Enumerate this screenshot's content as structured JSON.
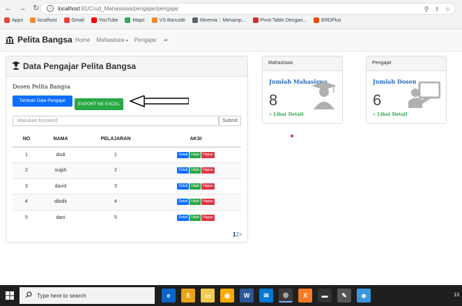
{
  "browser": {
    "url_host": "localhost",
    "url_path": ":81/Crud_Mahasiswa/pengajar/pengajar",
    "bookmarks": [
      {
        "label": "Apps",
        "color": "#e8453c"
      },
      {
        "label": "localhost",
        "color": "#f28b30"
      },
      {
        "label": "Gmail",
        "color": "#ea4335"
      },
      {
        "label": "YouTube",
        "color": "#ff0000"
      },
      {
        "label": "Maps",
        "color": "#34a853"
      },
      {
        "label": "VS Barcode",
        "color": "#f28b30"
      },
      {
        "label": "Minerva :: Menamp...",
        "color": "#5f6368"
      },
      {
        "label": "Pivot Table Dengan...",
        "color": "#d32f2f"
      },
      {
        "label": "ERDPlus",
        "color": "#e65100"
      }
    ]
  },
  "navbar": {
    "brand": "Pelita Bangsa",
    "menu": [
      {
        "label": "Home"
      },
      {
        "label": "Mahasiswa",
        "caret": "▾"
      },
      {
        "label": "Pengajar"
      },
      {
        "label": "⇥"
      }
    ]
  },
  "main": {
    "heading": "Data Pengajar Pelita Bangsa",
    "subtitle": "Dosen Pelita Bangsa",
    "add_button": "Tambah Data Pengajar",
    "excel_button": "EXPORT KE EXCEL",
    "search_placeholder": "Masukan Keyword",
    "submit_button": "Submit",
    "table": {
      "headers": [
        "NO",
        "NAMA",
        "PELAJARAN",
        "AKSI"
      ],
      "rows": [
        {
          "no": "1",
          "nama": "dodi",
          "pelajaran": "1"
        },
        {
          "no": "2",
          "nama": "sugih",
          "pelajaran": "2"
        },
        {
          "no": "3",
          "nama": "david",
          "pelajaran": "3"
        },
        {
          "no": "4",
          "nama": "dikdik",
          "pelajaran": "4"
        },
        {
          "no": "5",
          "nama": "dani",
          "pelajaran": "5"
        }
      ],
      "actions": {
        "detail": "Detail",
        "ubah": "Ubah",
        "hapus": "Hapus"
      }
    },
    "pagination": {
      "current": "1",
      "next": "2",
      "arrow": ">"
    }
  },
  "cards": [
    {
      "header": "Mahasiswa",
      "title": "Jumlah Mahasiswa",
      "count": "8",
      "link": "» Lihat Detail",
      "icon": "graduate-icon"
    },
    {
      "header": "Pengajar",
      "title": "Jumlah Dosen",
      "count": "6",
      "link": "» Lihat Detail",
      "icon": "teacher-icon"
    }
  ],
  "taskbar": {
    "search_placeholder": "Type here to search",
    "tray_text": "13"
  },
  "colors": {
    "primary": "#0d6efd",
    "success": "#28a745",
    "danger": "#dc3545",
    "link": "#2a6ab8"
  }
}
